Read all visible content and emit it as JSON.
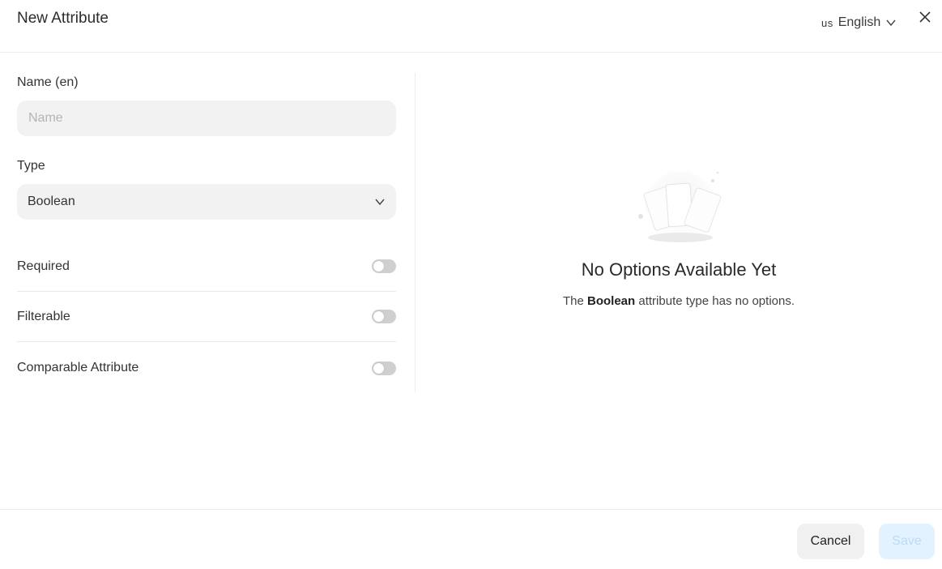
{
  "header": {
    "title": "New Attribute",
    "language": {
      "flag": "us",
      "label": "English"
    }
  },
  "form": {
    "name_label": "Name (en)",
    "name_placeholder": "Name",
    "name_value": "",
    "type_label": "Type",
    "type_value": "Boolean",
    "toggles": [
      {
        "label": "Required",
        "on": false
      },
      {
        "label": "Filterable",
        "on": false
      },
      {
        "label": "Comparable Attribute",
        "on": false
      }
    ]
  },
  "empty_state": {
    "title": "No Options Available Yet",
    "desc_prefix": "The",
    "desc_bold": "Boolean",
    "desc_suffix": "attribute type has no options."
  },
  "footer": {
    "cancel_label": "Cancel",
    "save_label": "Save"
  },
  "colors": {
    "save_bg": "#e3f2ff",
    "save_text": "#b9dcf7",
    "toggle_off": "#cfcfcf",
    "field_bg": "#f2f2f2"
  },
  "icons": [
    "chevron-down-icon",
    "close-icon",
    "empty-cards-icon"
  ]
}
